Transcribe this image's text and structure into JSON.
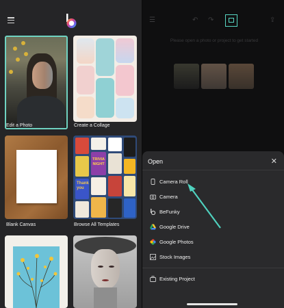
{
  "left": {
    "templates": [
      {
        "label": "Edit a Photo"
      },
      {
        "label": "Create a Collage"
      },
      {
        "label": "Blank Canvas"
      },
      {
        "label": "Browse All Templates"
      }
    ],
    "collage_text": [
      "TRIVIA",
      "NIGHT",
      "Thank",
      "you"
    ]
  },
  "right": {
    "prompt": "Please open a photo or project to get started",
    "sheet": {
      "title": "Open",
      "items": [
        {
          "label": "Camera Roll",
          "icon": "phone-icon"
        },
        {
          "label": "Camera",
          "icon": "camera-icon"
        },
        {
          "label": "BeFunky",
          "icon": "befunky-icon"
        },
        {
          "label": "Google Drive",
          "icon": "google-drive-icon"
        },
        {
          "label": "Google Photos",
          "icon": "google-photos-icon"
        },
        {
          "label": "Stock Images",
          "icon": "image-icon"
        },
        {
          "label": "Existing Project",
          "icon": "briefcase-icon"
        }
      ]
    }
  },
  "colors": {
    "accent": "#58d8c4",
    "arrow": "#4fd1be",
    "sheet_bg": "#2a2a2c"
  }
}
